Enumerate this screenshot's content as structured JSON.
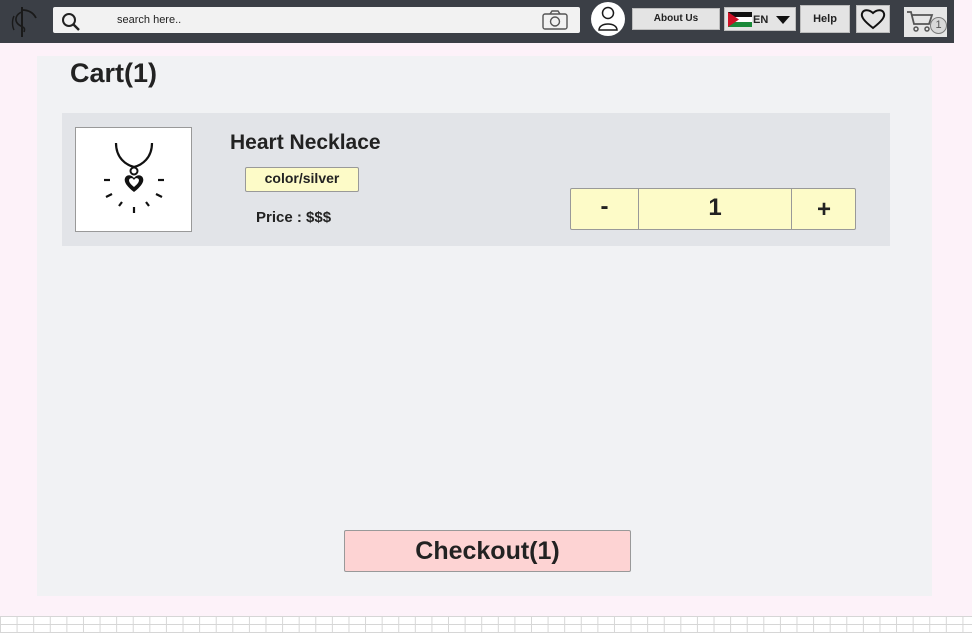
{
  "header": {
    "logo_icon": "rod-of-asclepius-icon",
    "search": {
      "placeholder": "search here..",
      "value": ""
    },
    "about_label": "About Us",
    "language": {
      "code": "EN",
      "flag": "jordan-flag-icon"
    },
    "help_label": "Help",
    "cart_count": "1"
  },
  "cart": {
    "title": "Cart(1)",
    "items": [
      {
        "name": "Heart Necklace",
        "image_icon": "heart-necklace-icon",
        "variant": "color/silver",
        "price": "Price : $$$",
        "quantity": "1",
        "minus_label": "-",
        "plus_label": "+"
      }
    ],
    "checkout_label": "Checkout(1)"
  },
  "colors": {
    "topbar": "#3b3f46",
    "page_background": "#fdf2f9",
    "panel": "#f1f2f4",
    "item_row": "#e2e4e8",
    "yellow_control": "#fdfbc8",
    "checkout_button": "#fdd3d3"
  }
}
